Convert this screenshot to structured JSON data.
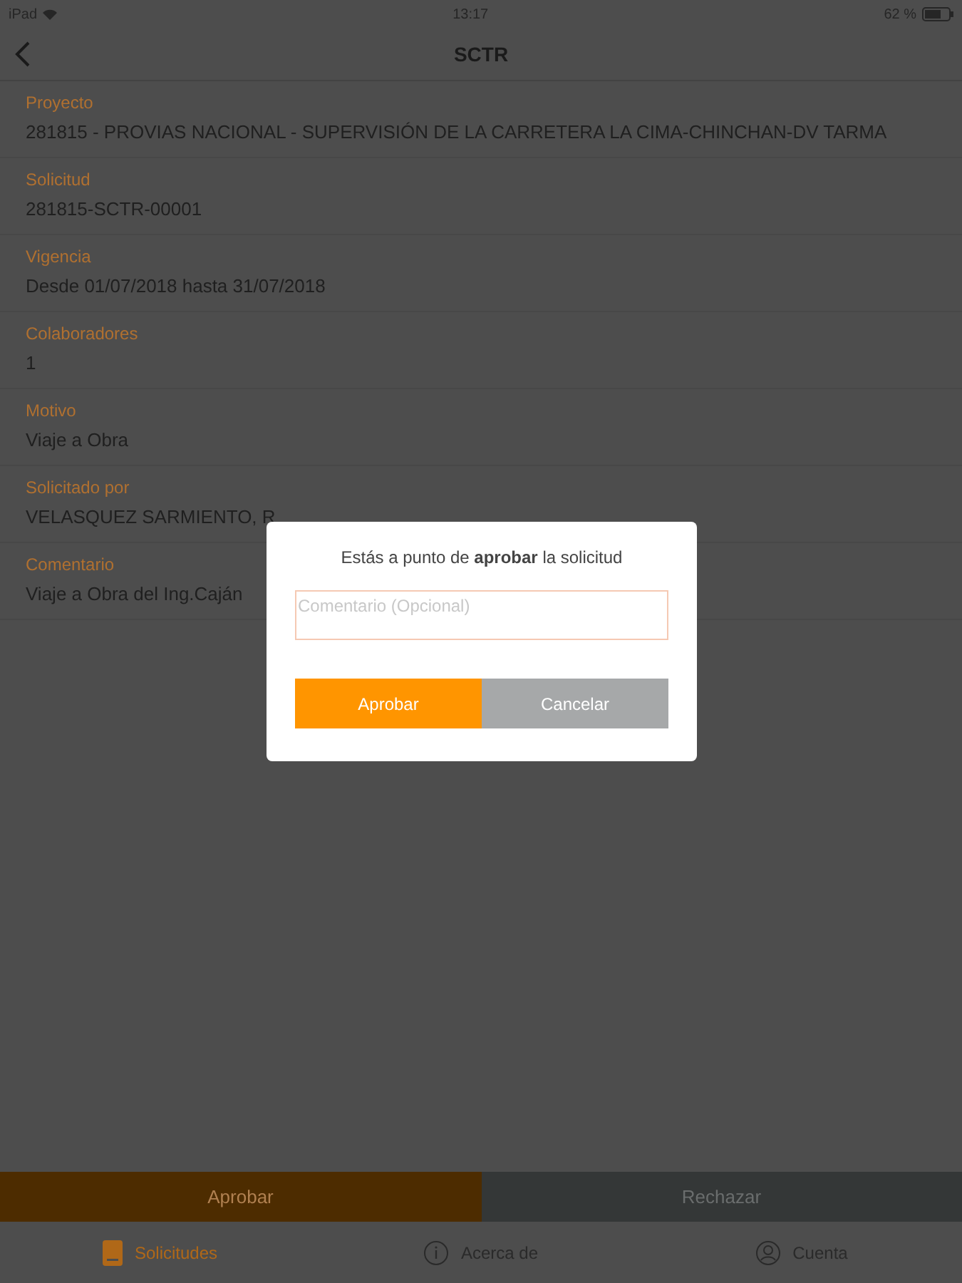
{
  "status_bar": {
    "device": "iPad",
    "time": "13:17",
    "battery": "62 %"
  },
  "nav": {
    "title": "SCTR"
  },
  "fields": [
    {
      "label": "Proyecto",
      "value": "281815 - PROVIAS NACIONAL - SUPERVISIÓN DE LA CARRETERA LA CIMA-CHINCHAN-DV TARMA"
    },
    {
      "label": "Solicitud",
      "value": "281815-SCTR-00001"
    },
    {
      "label": "Vigencia",
      "value": "Desde 01/07/2018 hasta 31/07/2018"
    },
    {
      "label": "Colaboradores",
      "value": "1"
    },
    {
      "label": "Motivo",
      "value": "Viaje a Obra"
    },
    {
      "label": "Solicitado por",
      "value": "VELASQUEZ SARMIENTO, R"
    },
    {
      "label": "Comentario",
      "value": "Viaje a Obra del Ing.Caján"
    }
  ],
  "actions": [
    {
      "label": "Aprobar",
      "kind": "primary"
    },
    {
      "label": "Rechazar",
      "kind": "secondary"
    }
  ],
  "tab_bar": [
    {
      "label": "Solicitudes",
      "kind": "document",
      "selected": true
    },
    {
      "label": "Acerca de",
      "kind": "info",
      "selected": false
    },
    {
      "label": "Cuenta",
      "kind": "person",
      "selected": false
    }
  ],
  "dialog": {
    "message": "Estás a punto de **aprobar** la solicitud",
    "placeholder": "Comentario (Opcional)",
    "buttons": [
      {
        "label": "Aprobar",
        "kind": "primary"
      },
      {
        "label": "Cancelar",
        "kind": "secondary"
      }
    ]
  }
}
